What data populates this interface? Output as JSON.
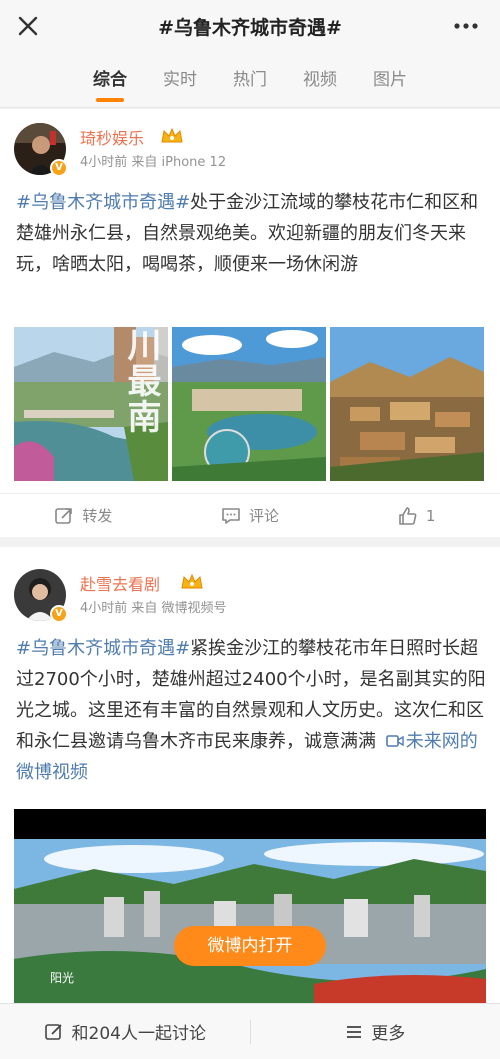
{
  "header": {
    "title": "#乌鲁木齐城市奇遇#"
  },
  "tabs": [
    {
      "label": "综合",
      "active": true
    },
    {
      "label": "实时",
      "active": false
    },
    {
      "label": "热门",
      "active": false
    },
    {
      "label": "视频",
      "active": false
    },
    {
      "label": "图片",
      "active": false
    }
  ],
  "posts": [
    {
      "author": "琦秒娱乐",
      "meta": "4小时前 来自 iPhone 12",
      "hashtag": "#乌鲁木齐城市奇遇#",
      "body": "处于金沙江流域的攀枝花市仁和区和楚雄州永仁县，自然景观绝美。欢迎新疆的朋友们冬天来玩，啥晒太阳，喝喝茶，顺便来一场休闲游",
      "image_overlay_text": "川最南",
      "actions": {
        "repost": "转发",
        "comment": "评论",
        "like": "1"
      }
    },
    {
      "author": "赴雪去看剧",
      "meta": "4小时前 来自 微博视频号",
      "hashtag": "#乌鲁木齐城市奇遇#",
      "body": "紧挨金沙江的攀枝花市年日照时长超过2700个小时，楚雄州超过2400个小时，是名副其实的阳光之城。这里还有丰富的自然景观和人文历史。这次仁和区和永仁县邀请乌鲁木齐市民来康养，诚意满满",
      "video_link": "未来网的微博视频",
      "open_button": "微博内打开",
      "video_caption": "阳光"
    }
  ],
  "bottom": {
    "discuss": "和204人一起讨论",
    "more": "更多"
  },
  "colors": {
    "accent": "#ff8200",
    "username": "#eb7350",
    "link": "#507daf"
  }
}
